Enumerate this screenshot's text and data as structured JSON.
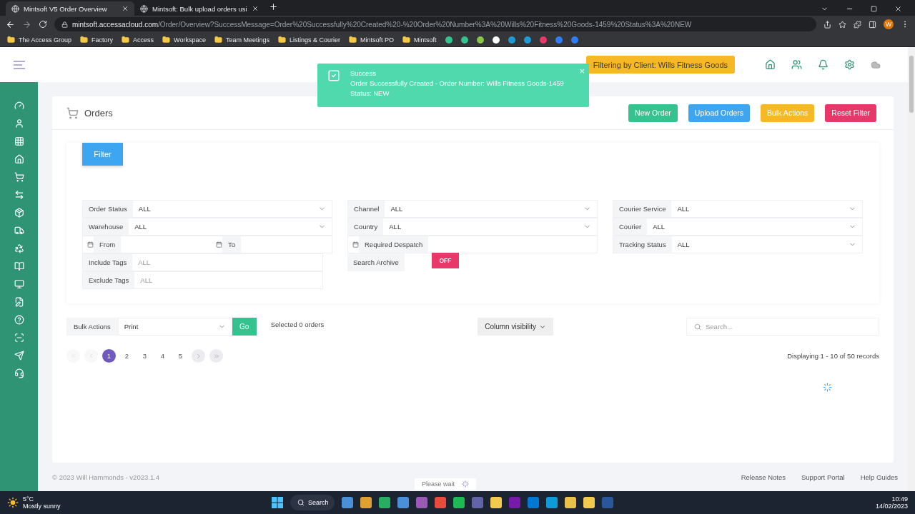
{
  "browser": {
    "tabs": [
      {
        "title": "Mintsoft V5 Order Overview",
        "selected": true
      },
      {
        "title": "Mintsoft: Bulk upload orders usi",
        "selected": false
      }
    ],
    "url_host": "mintsoft.accessacloud.com",
    "url_path": "/Order/Overview?SuccessMessage=Order%20Successfully%20Created%20-%20Order%20Number%3A%20Wills%20Fitness%20Goods-1459%20Status%3A%20NEW",
    "profile": "W",
    "bookmarks": [
      "The Access Group",
      "Factory",
      "Access",
      "Workspace",
      "Team Meetings",
      "Listings & Courier",
      "Mintsoft PO",
      "Mintsoft"
    ]
  },
  "app": {
    "client_filter": "Filtering by Client: Wills Fitness Goods",
    "toast": {
      "title": "Success",
      "lines": [
        "Order Successfully Created - Order Number: Wills Fitness Goods-1459",
        "Status: NEW"
      ],
      "close": "×"
    },
    "page_title": "Orders",
    "header_buttons": [
      {
        "label": "New Order",
        "color": "#34c38f"
      },
      {
        "label": "Upload Orders",
        "color": "#3ea6f0"
      },
      {
        "label": "Bulk Actions",
        "color": "#f6b825"
      },
      {
        "label": "Reset Filter",
        "color": "#e8386a"
      }
    ],
    "filter_tab": "Filter",
    "filter_columns": [
      [
        {
          "kind": "select",
          "label": "Order Status",
          "value": "ALL"
        },
        {
          "kind": "select",
          "label": "Warehouse",
          "value": "ALL"
        },
        {
          "kind": "daterange",
          "label": "From",
          "label2": "To"
        },
        {
          "kind": "tags",
          "label": "Include Tags",
          "placeholder": "ALL"
        },
        {
          "kind": "tags",
          "label": "Exclude Tags",
          "placeholder": "ALL"
        }
      ],
      [
        {
          "kind": "select",
          "label": "Channel",
          "value": "ALL"
        },
        {
          "kind": "select",
          "label": "Country",
          "value": "ALL"
        },
        {
          "kind": "date",
          "label": "Required Despatch"
        },
        {
          "kind": "toggle",
          "label": "Search Archive",
          "on": false,
          "state_label": "OFF"
        }
      ],
      [
        {
          "kind": "select",
          "label": "Courier Service",
          "value": "ALL"
        },
        {
          "kind": "select",
          "label": "Courier",
          "value": "ALL"
        },
        {
          "kind": "select",
          "label": "Tracking Status",
          "value": "ALL"
        }
      ]
    ],
    "bulk": {
      "label": "Bulk Actions",
      "value": "Print",
      "go": "Go"
    },
    "selected_text": "Selected 0 orders",
    "column_visibility": "Column visibility",
    "search_placeholder": "Search...",
    "pages": [
      {
        "label": "1",
        "selected": true
      },
      {
        "label": "2",
        "selected": false
      },
      {
        "label": "3",
        "selected": false
      },
      {
        "label": "4",
        "selected": false
      },
      {
        "label": "5",
        "selected": false
      }
    ],
    "records": "Displaying 1 - 10 of 50 records",
    "footer": {
      "copyright": "© 2023 Will Hammonds - v2023.1.4",
      "links": [
        "Release Notes",
        "Support Portal",
        "Help Guides"
      ],
      "please_wait": "Please wait"
    }
  },
  "taskbar": {
    "temperature": "5°C",
    "weather": "Mostly sunny",
    "search": "Search",
    "time": "10:49",
    "date": "14/02/2023"
  }
}
